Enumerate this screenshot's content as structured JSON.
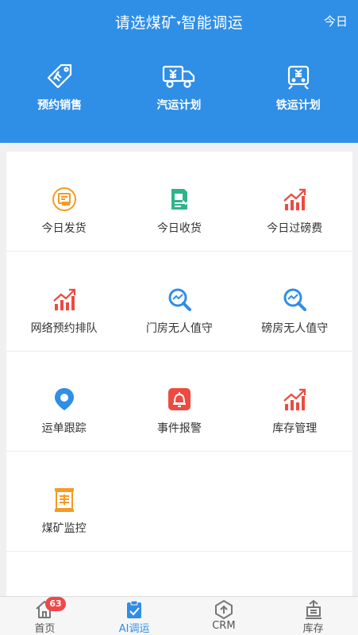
{
  "header": {
    "title_prefix": "请选煤矿",
    "title_caret": "▾",
    "title_suffix": "智能调运",
    "today_label": "今日"
  },
  "quick_actions": [
    {
      "label": "预约销售",
      "icon": "tag-icon"
    },
    {
      "label": "汽运计划",
      "icon": "truck-icon"
    },
    {
      "label": "铁运计划",
      "icon": "train-icon"
    }
  ],
  "grid": [
    [
      {
        "label": "今日发货",
        "icon": "dispatch-icon"
      },
      {
        "label": "今日收货",
        "icon": "receive-icon"
      },
      {
        "label": "今日过磅费",
        "icon": "trend-chart-icon"
      }
    ],
    [
      {
        "label": "网络预约排队",
        "icon": "trend-chart-icon"
      },
      {
        "label": "门房无人值守",
        "icon": "search-trend-icon"
      },
      {
        "label": "磅房无人值守",
        "icon": "search-trend-icon"
      }
    ],
    [
      {
        "label": "运单跟踪",
        "icon": "location-pin-icon"
      },
      {
        "label": "事件报警",
        "icon": "alarm-bell-icon"
      },
      {
        "label": "库存管理",
        "icon": "trend-chart-icon"
      }
    ],
    [
      {
        "label": "煤矿监控",
        "icon": "monitor-scroll-icon"
      }
    ]
  ],
  "tabbar": {
    "tabs": [
      {
        "label": "首页",
        "icon": "home-icon",
        "badge": "63",
        "active": false
      },
      {
        "label": "AI调运",
        "icon": "clipboard-check-icon",
        "active": true
      },
      {
        "label": "CRM",
        "icon": "upload-shield-icon",
        "active": false
      },
      {
        "label": "库存",
        "icon": "inventory-icon",
        "active": false
      }
    ]
  },
  "colors": {
    "primary": "#2f8ee6",
    "orange": "#f59a23",
    "green": "#2db58a",
    "red": "#ee4a3f",
    "blue": "#2f8ee6",
    "badge": "#f04848"
  }
}
